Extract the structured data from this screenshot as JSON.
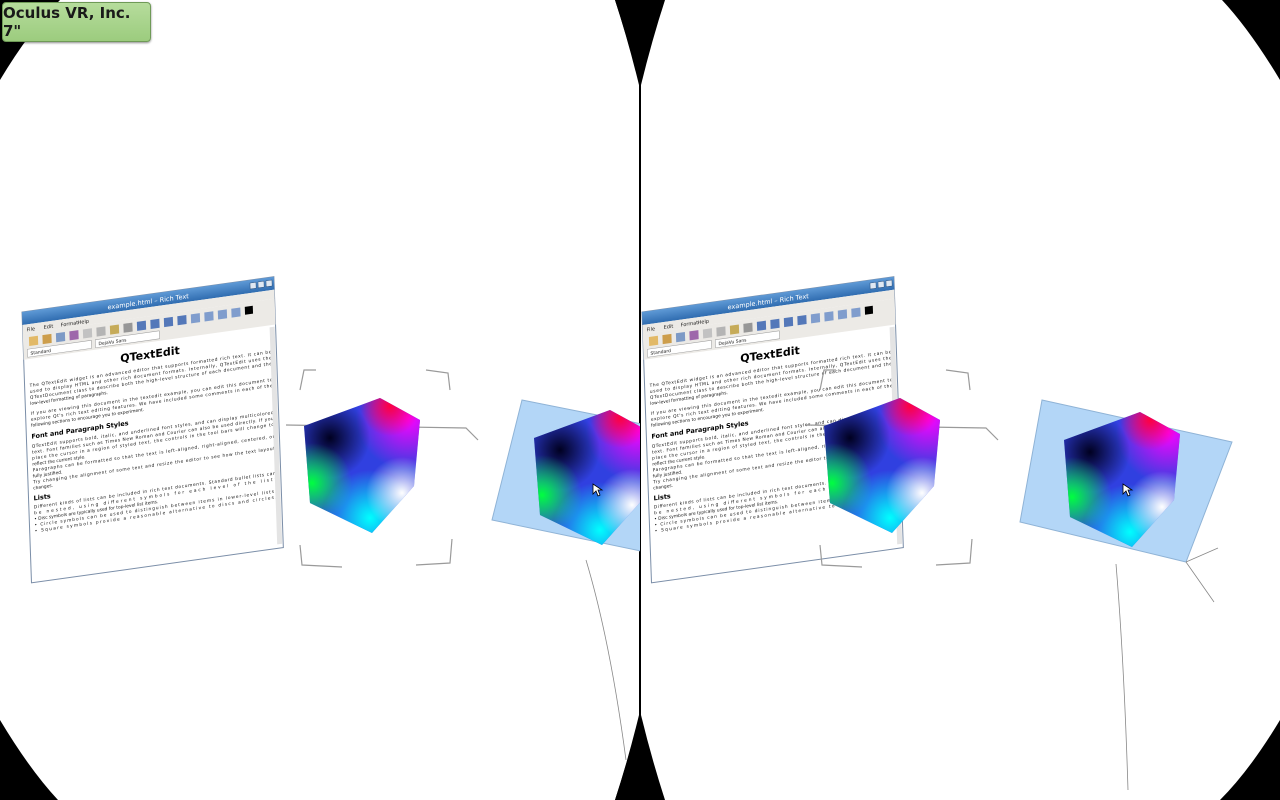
{
  "device_badge": {
    "label": "Oculus VR, Inc. 7\""
  },
  "window": {
    "title": "example.html – Rich Text",
    "menu": [
      "File",
      "Edit",
      "Format",
      "Help"
    ],
    "style_select": "Standard",
    "font_select": "DejaVu Sans",
    "heading": "QTextEdit",
    "intro_lines": [
      "The QTextEdit widget is an advanced editor that supports formatted rich text. It can be",
      "used to display HTML and other rich document formats. Internally, QTextEdit uses the",
      "QTextDocument class to describe both the high-level structure of each document and the",
      "low-level formatting of paragraphs."
    ],
    "para2_lines": [
      "If you are viewing this document in the textedit example, you can edit this document to",
      "explore Qt's rich text editing features. We have included some comments in each of the",
      "following sections to encourage you to experiment."
    ],
    "section1_heading": "Font and Paragraph Styles",
    "section1_lines": [
      "QTextEdit supports bold, italic, and underlined font styles, and can display multicolored",
      "text. Font families such as Times New Roman and Courier can also be used directly. If you",
      "place the cursor in a region of styled text, the controls in the tool bars will change to",
      "reflect the current style.",
      "Paragraphs can be formatted so that the text is left-aligned, right-aligned, centered, or",
      "fully justified.",
      "Try changing the alignment of some text and resize the editor to see how the text layout",
      "changes."
    ],
    "section2_heading": "Lists",
    "section2_lines": [
      "Different kinds of lists can be included in rich text documents. Standard bullet lists can",
      "be nested, using different symbols for each level of the list:",
      "• Disc symbols are typically used for top-level list items.",
      "• Circle symbols can be used to distinguish between items in lower-level lists.",
      "• Square symbols provide a reasonable alternative to discs and circles."
    ]
  },
  "colors": {
    "view_background": "#ffffff",
    "lens_background": "#000000",
    "titlebar": "#3f7ec3",
    "panel_blue": "#b3d6f7",
    "badge_green": "#a8d48c"
  }
}
